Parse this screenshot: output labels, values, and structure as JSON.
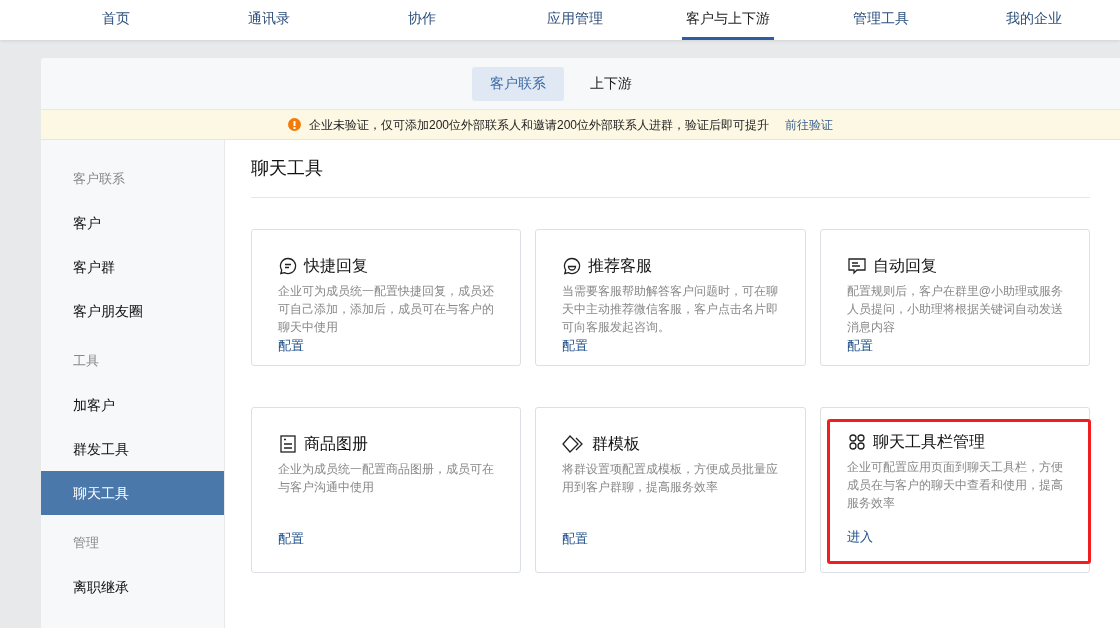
{
  "top_nav": [
    {
      "label": "首页",
      "selected": false
    },
    {
      "label": "通讯录",
      "selected": false
    },
    {
      "label": "协作",
      "selected": false
    },
    {
      "label": "应用管理",
      "selected": false
    },
    {
      "label": "客户与上下游",
      "selected": true
    },
    {
      "label": "管理工具",
      "selected": false
    },
    {
      "label": "我的企业",
      "selected": false
    }
  ],
  "sub_tabs": [
    {
      "label": "客户联系",
      "selected": true
    },
    {
      "label": "上下游",
      "selected": false
    }
  ],
  "notice": {
    "text": "企业未验证，仅可添加200位外部联系人和邀请200位外部联系人进群，验证后即可提升",
    "link": "前往验证"
  },
  "sidebar": [
    {
      "heading": "客户联系",
      "items": [
        {
          "label": "客户",
          "selected": false
        },
        {
          "label": "客户群",
          "selected": false
        },
        {
          "label": "客户朋友圈",
          "selected": false
        }
      ]
    },
    {
      "heading": "工具",
      "items": [
        {
          "label": "加客户",
          "selected": false
        },
        {
          "label": "群发工具",
          "selected": false
        },
        {
          "label": "聊天工具",
          "selected": true
        }
      ]
    },
    {
      "heading": "管理",
      "items": [
        {
          "label": "离职继承",
          "selected": false
        }
      ]
    }
  ],
  "page_title": "聊天工具",
  "cards": [
    {
      "kind": "quick-reply",
      "title": "快捷回复",
      "description": "企业可为成员统一配置快捷回复，成员还可自己添加，添加后，成员可在与客户的聊天中使用",
      "action": "配置",
      "highlighted": false
    },
    {
      "kind": "service",
      "title": "推荐客服",
      "description": "当需要客服帮助解答客户问题时，可在聊天中主动推荐微信客服，客户点击名片即可向客服发起咨询。",
      "action": "配置",
      "highlighted": false
    },
    {
      "kind": "auto-reply",
      "title": "自动回复",
      "description": "配置规则后，客户在群里@小助理或服务人员提问，小助理将根据关键词自动发送消息内容",
      "action": "配置",
      "highlighted": false
    },
    {
      "kind": "catalog",
      "title": "商品图册",
      "description": "企业为成员统一配置商品图册，成员可在与客户沟通中使用",
      "action": "配置",
      "highlighted": false
    },
    {
      "kind": "template",
      "title": "群模板",
      "description": "将群设置项配置成模板，方便成员批量应用到客户群聊，提高服务效率",
      "action": "配置",
      "highlighted": false
    },
    {
      "kind": "toolbar",
      "title": "聊天工具栏管理",
      "description": "企业可配置应用页面到聊天工具栏，方便成员在与客户的聊天中查看和使用，提高服务效率",
      "action": "进入",
      "highlighted": true
    }
  ]
}
